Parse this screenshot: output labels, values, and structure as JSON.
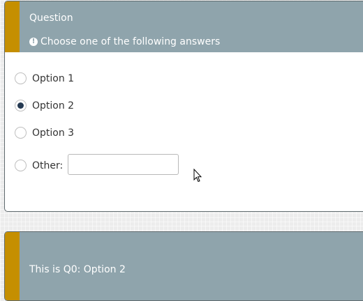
{
  "question": {
    "title": "Question",
    "help_text": "Choose one of the following answers",
    "help_icon": "exclamation-circle-icon",
    "accent_color": "#c58f00",
    "header_color": "#8fa4ac",
    "options": [
      {
        "label": "Option 1",
        "checked": false
      },
      {
        "label": "Option 2",
        "checked": true
      },
      {
        "label": "Option 3",
        "checked": false
      }
    ],
    "other": {
      "label": "Other:",
      "value": "",
      "checked": false
    }
  },
  "result": {
    "text": "This is Q0: Option 2"
  }
}
